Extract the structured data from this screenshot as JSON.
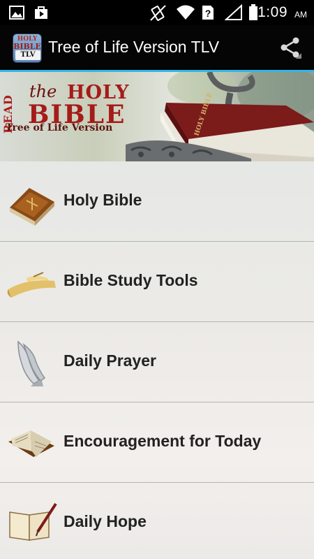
{
  "status_bar": {
    "time": "1:09",
    "ampm": "AM",
    "icons": [
      "image-icon",
      "store-icon",
      "vibrate-icon",
      "wifi-icon",
      "no-sim-icon",
      "signal-icon",
      "battery-icon"
    ]
  },
  "action_bar": {
    "title": "Tree of Life Version TLV",
    "app_icon": {
      "top": "HOLY",
      "middle": "BIBLE",
      "bottom": "TLV"
    },
    "share_icon": "share-icon"
  },
  "banner": {
    "read": "READ",
    "the": "the",
    "holy": "HOLY",
    "bible": "BIBLE",
    "subtitle": "Tree of Life Version",
    "book_spine": "HOLY BIBLE"
  },
  "menu": {
    "items": [
      {
        "label": "Holy Bible",
        "icon": "bible-book-icon"
      },
      {
        "label": "Bible Study Tools",
        "icon": "scroll-icon"
      },
      {
        "label": "Daily Prayer",
        "icon": "praying-hands-icon"
      },
      {
        "label": "Encouragement for Today",
        "icon": "open-book-icon"
      },
      {
        "label": "Daily Hope",
        "icon": "book-quill-icon"
      }
    ]
  },
  "colors": {
    "accent": "#34b5e5",
    "banner_title": "#a51b18",
    "menu_text": "#222222"
  }
}
